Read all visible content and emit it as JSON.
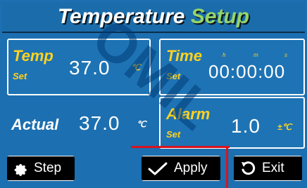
{
  "title": {
    "part1": "Temperature",
    "part2": "Setup"
  },
  "temp_set": {
    "label": "Temp",
    "sub": "Set",
    "value": "37.0",
    "unit": "℃"
  },
  "time_set": {
    "label": "Time",
    "sub": "Set",
    "value": "00:00:00",
    "h": "h",
    "m": "m",
    "s": "s"
  },
  "actual": {
    "label": "Actual",
    "value": "37.0",
    "unit": "℃"
  },
  "alarm_set": {
    "label": "Alarm",
    "sub": "Set",
    "value": "1.0",
    "unit": "±℃"
  },
  "buttons": {
    "step": {
      "label": "Step",
      "icon": "gear-icon"
    },
    "apply": {
      "label": "Apply",
      "icon": "check-icon"
    },
    "exit": {
      "label": "Exit",
      "icon": "undo-icon"
    }
  },
  "watermark": "OMIL",
  "colors": {
    "background": "#1c6fb0",
    "label": "#ffd21f",
    "title_accent": "#93d46a"
  }
}
